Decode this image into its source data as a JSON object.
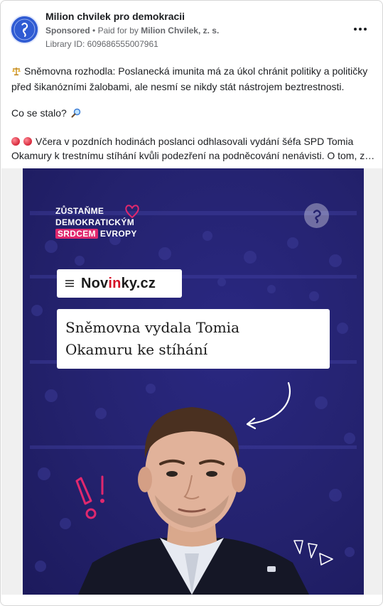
{
  "post": {
    "page_name": "Milion chvilek pro demokracii",
    "sponsored_label": "Sponsored",
    "paid_for_prefix": "Paid for by",
    "payer": "Milion Chvilek, z. s.",
    "library_id": "Library ID: 609686555007961",
    "more_icon": "ellipsis-icon"
  },
  "body": {
    "line1": "Sněmovna rozhodla: Poslanecká imunita má za úkol chránit politiky a političky",
    "line2": "před šikanózními žalobami, ale nesmí se nikdy stát nástrojem beztrestnosti.",
    "line3": "Co se stalo?",
    "line4": "Včera v pozdních hodinách poslanci odhlasovali vydání šéfa SPD Tomia",
    "line5": "Okamury k trestnímu stíhání kvůli podezření na podněcování nenávisti. O tom, zd…"
  },
  "creative": {
    "logo_line1": "ZŮSTAŇME",
    "logo_line2": "DEMOKRATICKÝM",
    "logo_line3_pill": "SRDCEM",
    "logo_line3_rest": "EVROPY",
    "source_prefix": "Nov",
    "source_accent": "in",
    "source_suffix": "ky.cz",
    "headline_line1": "Sněmovna vydala Tomia",
    "headline_line2": "Okamuru ke stíhání"
  },
  "colors": {
    "background_navy": "#24226e",
    "accent_pink": "#e0286e",
    "novinky_red": "#d50f25"
  }
}
